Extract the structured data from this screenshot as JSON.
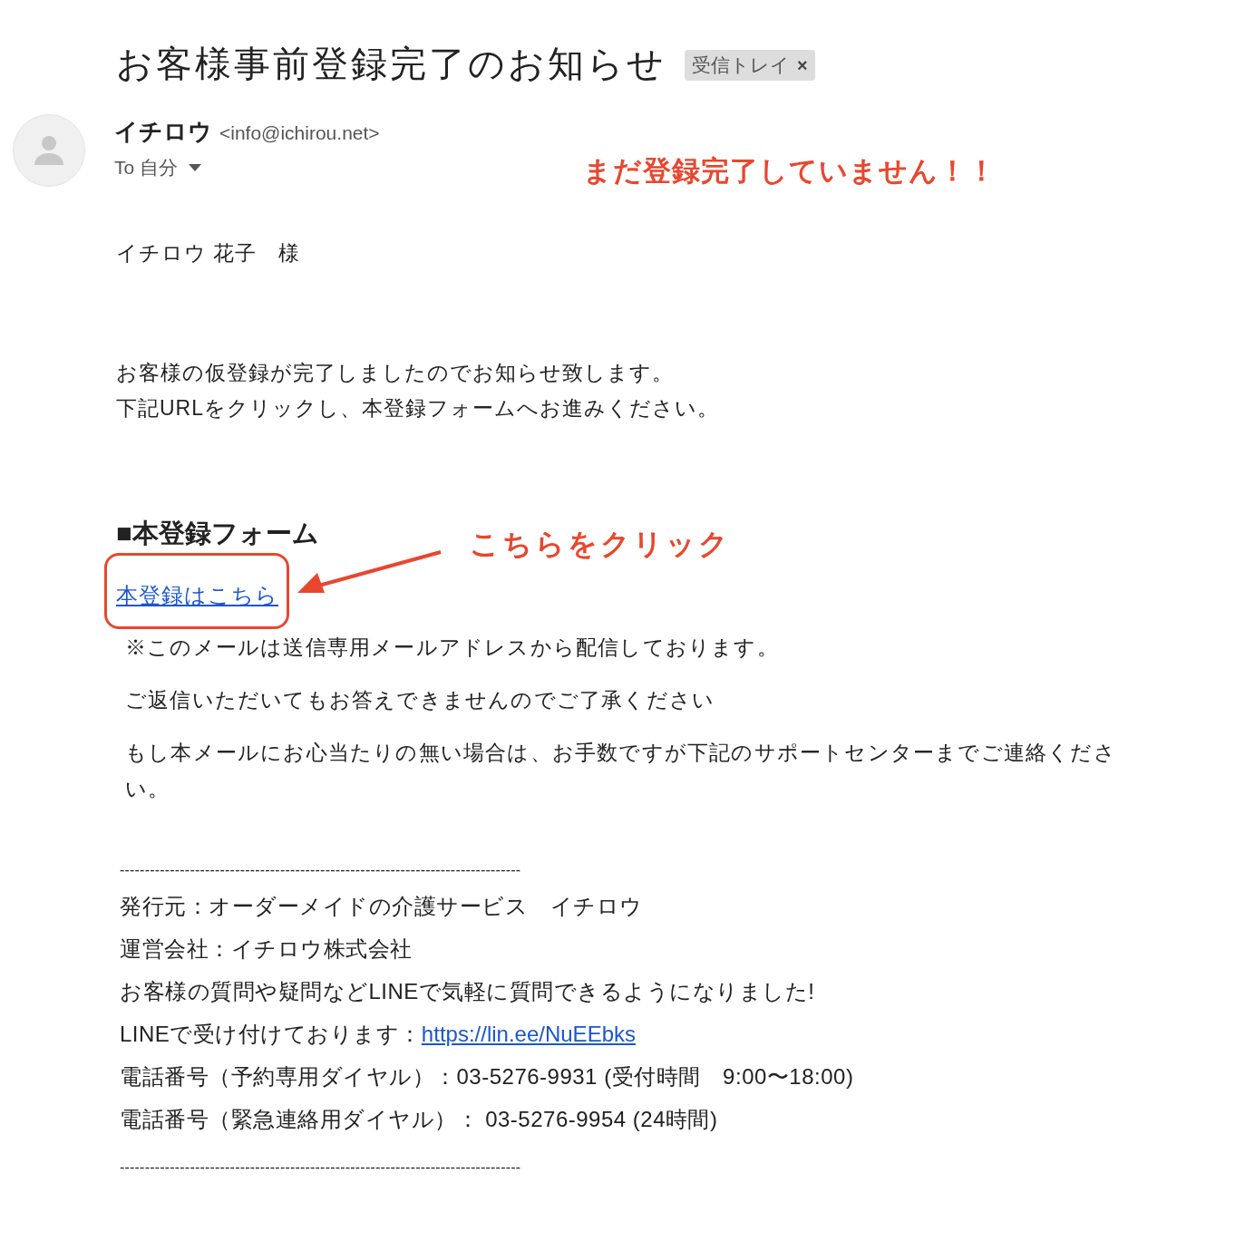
{
  "subject": "お客様事前登録完了のお知らせ",
  "label": {
    "text": "受信トレイ",
    "close": "×"
  },
  "sender": {
    "name": "イチロウ",
    "email": "<info@ichirou.net>",
    "to": "To 自分"
  },
  "greeting": "イチロウ 花子　様",
  "intro": [
    "お客様の仮登録が完了しましたのでお知らせ致します。",
    "下記URLをクリックし、本登録フォームへお進みください。"
  ],
  "section_heading": "■本登録フォーム",
  "register_link": "本登録はこちら",
  "notes": [
    "※このメールは送信専用メールアドレスから配信しております。",
    "ご返信いただいてもお答えできませんのでご了承ください",
    "もし本メールにお心当たりの無い場合は、お手数ですが下記のサポートセンターまでご連絡ください。"
  ],
  "separator": "--------------------------------------------------------------------------------",
  "footer": [
    {
      "kind": "text",
      "text": "発行元：オーダーメイドの介護サービス　イチロウ"
    },
    {
      "kind": "text",
      "text": "運営会社：イチロウ株式会社"
    },
    {
      "kind": "text",
      "text": "お客様の質問や疑問などLINEで気軽に質問できるようになりました!"
    },
    {
      "kind": "link",
      "text": "LINEで受け付けております：",
      "link": "https://lin.ee/NuEEbks"
    },
    {
      "kind": "text",
      "text": "電話番号（予約専用ダイヤル）：03-5276-9931 (受付時間　9:00〜18:00)"
    },
    {
      "kind": "text",
      "text": "電話番号（緊急連絡用ダイヤル）： 03-5276-9954 (24時間)"
    }
  ],
  "annotations": [
    {
      "kind": "warning",
      "text": "まだ登録完了していません！！"
    },
    {
      "kind": "callout",
      "text": "こちらをクリック"
    }
  ]
}
